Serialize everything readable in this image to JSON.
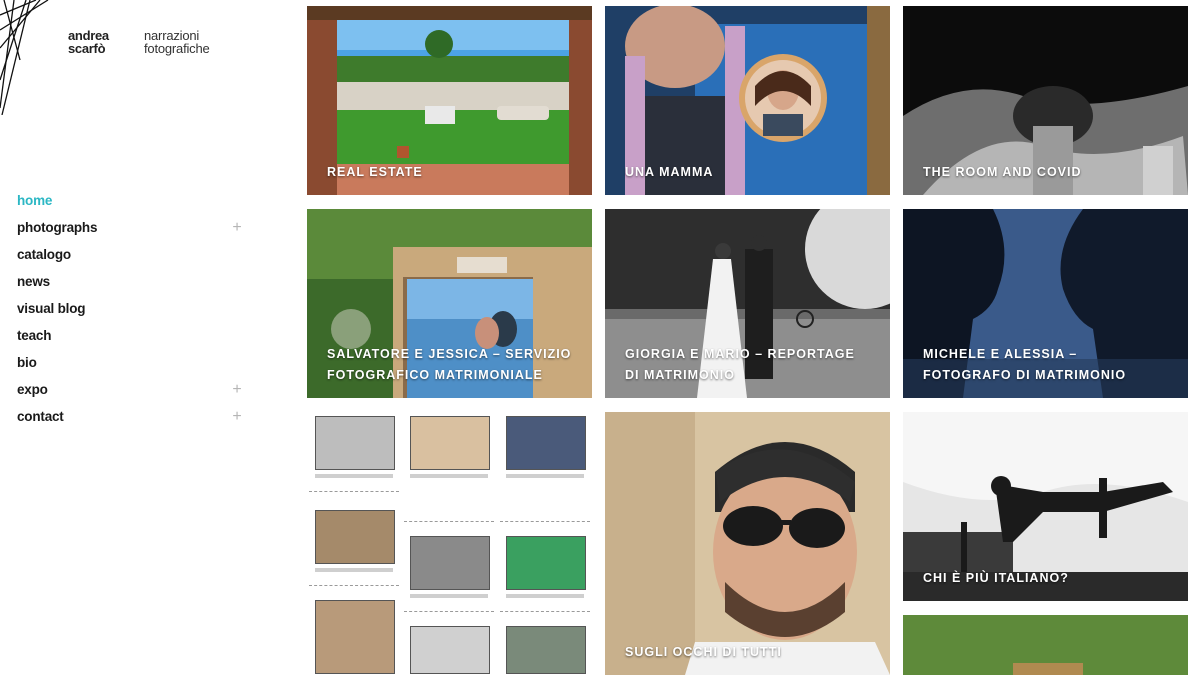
{
  "brand": {
    "name_line1": "andrea",
    "name_line2": "scarfò",
    "tagline_line1": "narrazioni",
    "tagline_line2": "fotografiche"
  },
  "nav": {
    "items": [
      {
        "label": "home",
        "active": true,
        "expandable": false
      },
      {
        "label": "photographs",
        "active": false,
        "expandable": true
      },
      {
        "label": "catalogo",
        "active": false,
        "expandable": false
      },
      {
        "label": "news",
        "active": false,
        "expandable": false
      },
      {
        "label": "visual blog",
        "active": false,
        "expandable": false
      },
      {
        "label": "teach",
        "active": false,
        "expandable": false
      },
      {
        "label": "bio",
        "active": false,
        "expandable": false
      },
      {
        "label": "expo",
        "active": false,
        "expandable": true
      },
      {
        "label": "contact",
        "active": false,
        "expandable": true
      }
    ],
    "expand_symbol": "+"
  },
  "gallery": {
    "tiles": [
      {
        "caption": "REAL ESTATE"
      },
      {
        "caption": "UNA MAMMA"
      },
      {
        "caption": "THE ROOM AND COVID"
      },
      {
        "caption": "SALVATORE E JESSICA – SERVIZIO FOTOGRAFICO MATRIMONIALE"
      },
      {
        "caption": "GIORGIA E MARIO – REPORTAGE DI MATRIMONIO"
      },
      {
        "caption": "MICHELE E ALESSIA – FOTOGRAFO DI MATRIMONIO"
      },
      {
        "caption": ""
      },
      {
        "caption": "SUGLI OCCHI DI TUTTI"
      },
      {
        "caption": "CHI È PIÙ ITALIANO?"
      },
      {
        "caption": ""
      }
    ]
  },
  "colors": {
    "accent": "#2bb7c4",
    "text": "#1a1a1a",
    "expand_icon": "#b5b5b5"
  }
}
